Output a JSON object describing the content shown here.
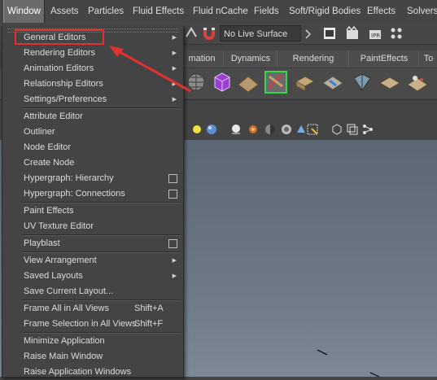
{
  "menubar": {
    "items": [
      "Window",
      "Assets",
      "Particles",
      "Fluid Effects",
      "Fluid nCache",
      "Fields",
      "Soft/Rigid Bodies",
      "Effects",
      "Solvers"
    ],
    "active": "Window"
  },
  "statusline": {
    "live_surface": "No Live Surface"
  },
  "shelf": {
    "tabs": [
      "mation",
      "Dynamics",
      "Rendering",
      "PaintEffects",
      "To"
    ]
  },
  "window_menu": {
    "items": [
      {
        "label": "General Editors",
        "submenu": true,
        "highlighted": true
      },
      {
        "label": "Rendering Editors",
        "submenu": true
      },
      {
        "label": "Animation Editors",
        "submenu": true
      },
      {
        "label": "Relationship Editors",
        "submenu": true
      },
      {
        "label": "Settings/Preferences",
        "submenu": true
      },
      {
        "label": "Attribute Editor"
      },
      {
        "label": "Outliner"
      },
      {
        "label": "Node Editor"
      },
      {
        "label": "Create Node"
      },
      {
        "label": "Hypergraph: Hierarchy",
        "checkbox": true
      },
      {
        "label": "Hypergraph: Connections",
        "checkbox": true
      },
      {
        "label": "Paint Effects"
      },
      {
        "label": "UV Texture Editor"
      },
      {
        "label": "Playblast",
        "checkbox": true
      },
      {
        "label": "View Arrangement",
        "submenu": true
      },
      {
        "label": "Saved Layouts",
        "submenu": true
      },
      {
        "label": "Save Current Layout..."
      },
      {
        "label": "Frame All in All Views",
        "shortcut": "Shift+A"
      },
      {
        "label": "Frame Selection in All Views",
        "shortcut": "Shift+F"
      },
      {
        "label": "Minimize Application"
      },
      {
        "label": "Raise Main Window"
      },
      {
        "label": "Raise Application Windows"
      }
    ]
  },
  "colors": {
    "annotation": "#e03030",
    "menu_bg": "#444444",
    "viewport_top": "#5b6773",
    "viewport_bottom": "#7c8896"
  },
  "icons": {
    "submenu": "triangle-right-icon",
    "checkbox": "option-box-icon"
  }
}
